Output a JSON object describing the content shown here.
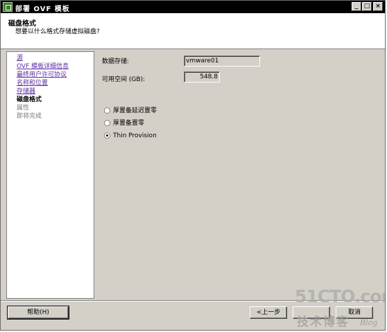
{
  "window": {
    "title": "部署 OVF 模板",
    "controls": {
      "minimize": "_",
      "maximize": "□",
      "close": "×"
    }
  },
  "header": {
    "title": "磁盘格式",
    "subtitle": "想要以什么格式存储虚拟磁盘?"
  },
  "nav": {
    "items": [
      {
        "label": "源",
        "state": "link"
      },
      {
        "label": "OVF 模板详细信息",
        "state": "link"
      },
      {
        "label": "最终用户许可协议",
        "state": "link"
      },
      {
        "label": "名称和位置",
        "state": "link"
      },
      {
        "label": "存储器",
        "state": "link"
      },
      {
        "label": "磁盘格式",
        "state": "current"
      },
      {
        "label": "属性",
        "state": "disabled"
      },
      {
        "label": "即将完成",
        "state": "disabled"
      }
    ]
  },
  "main": {
    "datastore": {
      "label": "数据存储:",
      "value": "vmware01"
    },
    "free_space": {
      "label": "可用空间 (GB):",
      "value": "548.8"
    },
    "disk_format_options": [
      {
        "label": "厚置备延迟置零",
        "checked": false
      },
      {
        "label": "厚置备置零",
        "checked": false
      },
      {
        "label": "Thin Provision",
        "checked": true
      }
    ]
  },
  "footer": {
    "help_label": "帮助(H)",
    "back_label": "<上一步",
    "next_label": "",
    "cancel_label": "取消"
  },
  "watermark": {
    "site": "51CTO.com",
    "tagline": "技术博客",
    "blog": "Blog"
  },
  "colors": {
    "title_bar": "#000000",
    "window_bg": "#d4d0c8",
    "link": "#5e2ea0",
    "disabled": "#7b7b7b"
  }
}
